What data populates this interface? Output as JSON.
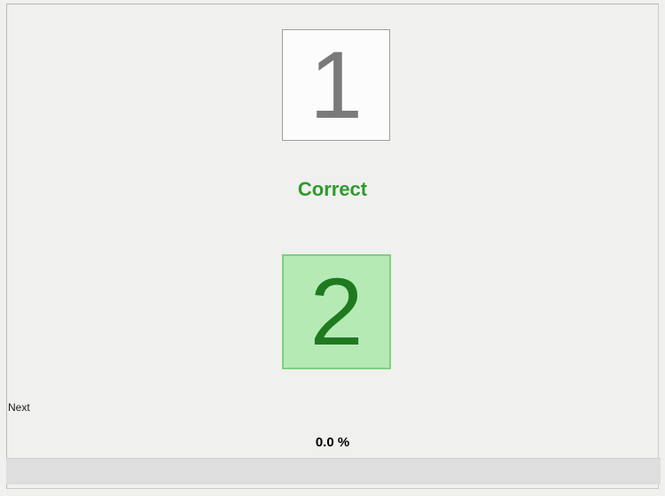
{
  "cards": {
    "top_value": "1",
    "bottom_value": "2"
  },
  "status": {
    "text": "Correct"
  },
  "controls": {
    "next_label": "Next"
  },
  "progress": {
    "percent_text": "0.0 %"
  }
}
